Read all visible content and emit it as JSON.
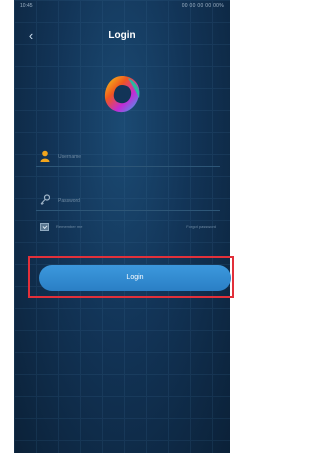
{
  "status_bar": {
    "left_text": "10:45",
    "right_text": "00 00 00 00 00%"
  },
  "header": {
    "back_symbol": "‹",
    "title": "Login"
  },
  "form": {
    "username_placeholder": "Username",
    "password_placeholder": "Password",
    "remember_label": "Remember me",
    "forgot_label": "Forgot password",
    "login_label": "Login"
  },
  "colors": {
    "background": "#123457",
    "button": "#2f88cf",
    "highlight": "#e2303a",
    "user_icon": "#f2a51c"
  },
  "icons": [
    "back-icon",
    "app-logo",
    "user-icon",
    "key-icon",
    "checkbox-icon"
  ]
}
